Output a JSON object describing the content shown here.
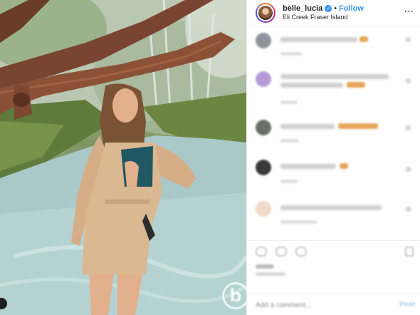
{
  "post": {
    "username": "belle_lucia",
    "verified_icon": "verified-badge-icon",
    "separator": "•",
    "follow_label": "Follow",
    "location": "Eli Creek Fraser Island",
    "more_icon": "···"
  },
  "comment_box": {
    "placeholder": "Add a comment...",
    "post_label": "Post"
  },
  "watermark": {
    "glyph": "b"
  },
  "colors": {
    "accent": "#3897f0",
    "text": "#262626",
    "border": "#efefef",
    "story_ring": [
      "#f58529",
      "#dd2a7b",
      "#8134af",
      "#515bd4"
    ]
  }
}
